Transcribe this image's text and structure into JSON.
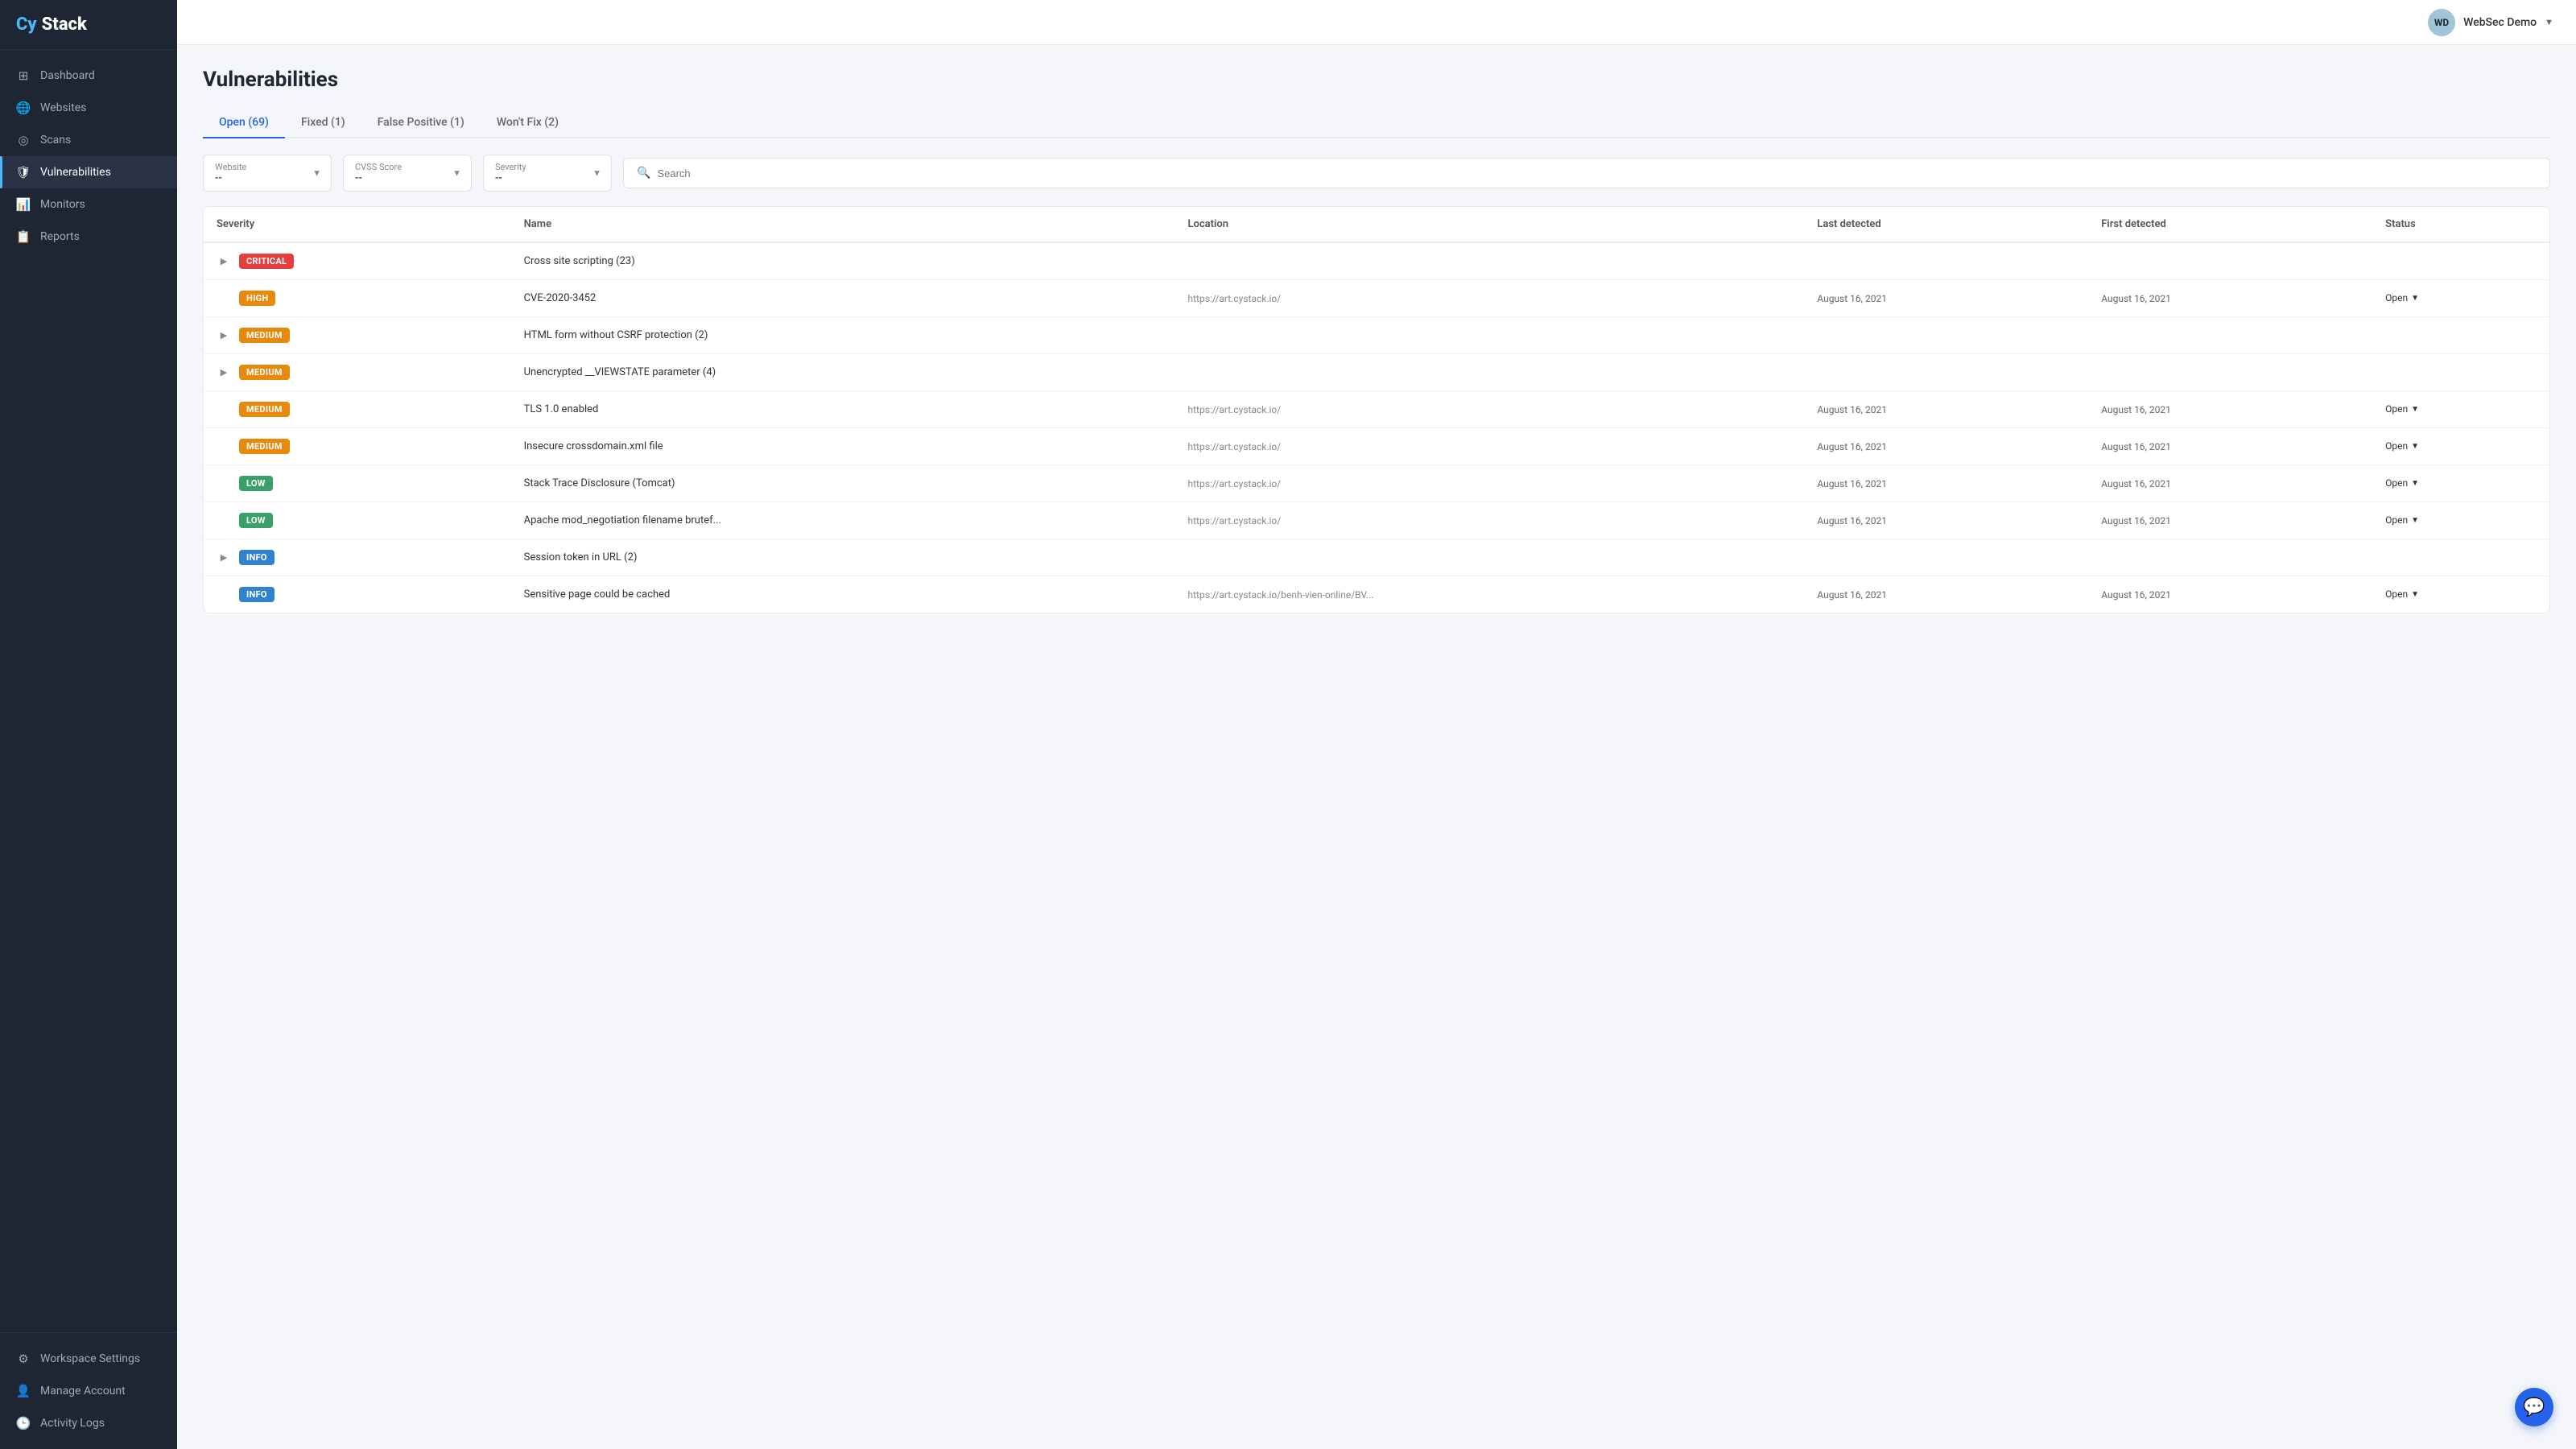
{
  "logo": {
    "cy": "Cy",
    "stack": "Stack"
  },
  "sidebar": {
    "items": [
      {
        "id": "dashboard",
        "label": "Dashboard",
        "icon": "⊞",
        "active": false
      },
      {
        "id": "websites",
        "label": "Websites",
        "icon": "🌐",
        "active": false
      },
      {
        "id": "scans",
        "label": "Scans",
        "icon": "◎",
        "active": false
      },
      {
        "id": "vulnerabilities",
        "label": "Vulnerabilities",
        "icon": "🛡",
        "active": true
      },
      {
        "id": "monitors",
        "label": "Monitors",
        "icon": "📊",
        "active": false
      },
      {
        "id": "reports",
        "label": "Reports",
        "icon": "📋",
        "active": false
      }
    ],
    "bottom_items": [
      {
        "id": "workspace-settings",
        "label": "Workspace Settings",
        "icon": "⚙",
        "active": false
      },
      {
        "id": "manage-account",
        "label": "Manage Account",
        "icon": "👤",
        "active": false
      },
      {
        "id": "activity-logs",
        "label": "Activity Logs",
        "icon": "🕒",
        "active": false
      }
    ]
  },
  "topbar": {
    "user": {
      "initials": "WD",
      "name": "WebSec Demo",
      "avatar_bg": "#a0c4d8"
    }
  },
  "page": {
    "title": "Vulnerabilities",
    "tabs": [
      {
        "id": "open",
        "label": "Open (69)",
        "active": true
      },
      {
        "id": "fixed",
        "label": "Fixed (1)",
        "active": false
      },
      {
        "id": "false-positive",
        "label": "False Positive (1)",
        "active": false
      },
      {
        "id": "wont-fix",
        "label": "Won't Fix (2)",
        "active": false
      }
    ]
  },
  "filters": {
    "website": {
      "label": "Website",
      "value": "--"
    },
    "cvss_score": {
      "label": "CVSS Score",
      "value": "--"
    },
    "severity": {
      "label": "Severity",
      "value": "--"
    },
    "search": {
      "placeholder": "Search"
    }
  },
  "table": {
    "columns": [
      "Severity",
      "Name",
      "Location",
      "Last detected",
      "First detected",
      "Status"
    ],
    "rows": [
      {
        "expandable": true,
        "severity": "CRITICAL",
        "severity_class": "badge-critical",
        "name": "Cross site scripting (23)",
        "location": "",
        "last_detected": "",
        "first_detected": "",
        "status": ""
      },
      {
        "expandable": false,
        "severity": "HIGH",
        "severity_class": "badge-high",
        "name": "CVE-2020-3452",
        "location": "https://art.cystack.io/",
        "last_detected": "August 16, 2021",
        "first_detected": "August 16, 2021",
        "status": "Open"
      },
      {
        "expandable": true,
        "severity": "MEDIUM",
        "severity_class": "badge-medium",
        "name": "HTML form without CSRF protection (2)",
        "location": "",
        "last_detected": "",
        "first_detected": "",
        "status": ""
      },
      {
        "expandable": true,
        "severity": "MEDIUM",
        "severity_class": "badge-medium",
        "name": "Unencrypted __VIEWSTATE parameter (4)",
        "location": "",
        "last_detected": "",
        "first_detected": "",
        "status": ""
      },
      {
        "expandable": false,
        "severity": "MEDIUM",
        "severity_class": "badge-medium",
        "name": "TLS 1.0 enabled",
        "location": "https://art.cystack.io/",
        "last_detected": "August 16, 2021",
        "first_detected": "August 16, 2021",
        "status": "Open"
      },
      {
        "expandable": false,
        "severity": "MEDIUM",
        "severity_class": "badge-medium",
        "name": "Insecure crossdomain.xml file",
        "location": "https://art.cystack.io/",
        "last_detected": "August 16, 2021",
        "first_detected": "August 16, 2021",
        "status": "Open"
      },
      {
        "expandable": false,
        "severity": "LOW",
        "severity_class": "badge-low",
        "name": "Stack Trace Disclosure (Tomcat)",
        "location": "https://art.cystack.io/",
        "last_detected": "August 16, 2021",
        "first_detected": "August 16, 2021",
        "status": "Open"
      },
      {
        "expandable": false,
        "severity": "LOW",
        "severity_class": "badge-low",
        "name": "Apache mod_negotiation filename brutef...",
        "location": "https://art.cystack.io/",
        "last_detected": "August 16, 2021",
        "first_detected": "August 16, 2021",
        "status": "Open"
      },
      {
        "expandable": true,
        "severity": "INFO",
        "severity_class": "badge-info",
        "name": "Session token in URL (2)",
        "location": "",
        "last_detected": "",
        "first_detected": "",
        "status": ""
      },
      {
        "expandable": false,
        "severity": "INFO",
        "severity_class": "badge-info",
        "name": "Sensitive page could be cached",
        "location": "https://art.cystack.io/benh-vien-online/BV...",
        "last_detected": "August 16, 2021",
        "first_detected": "August 16, 2021",
        "status": "Open"
      }
    ]
  }
}
